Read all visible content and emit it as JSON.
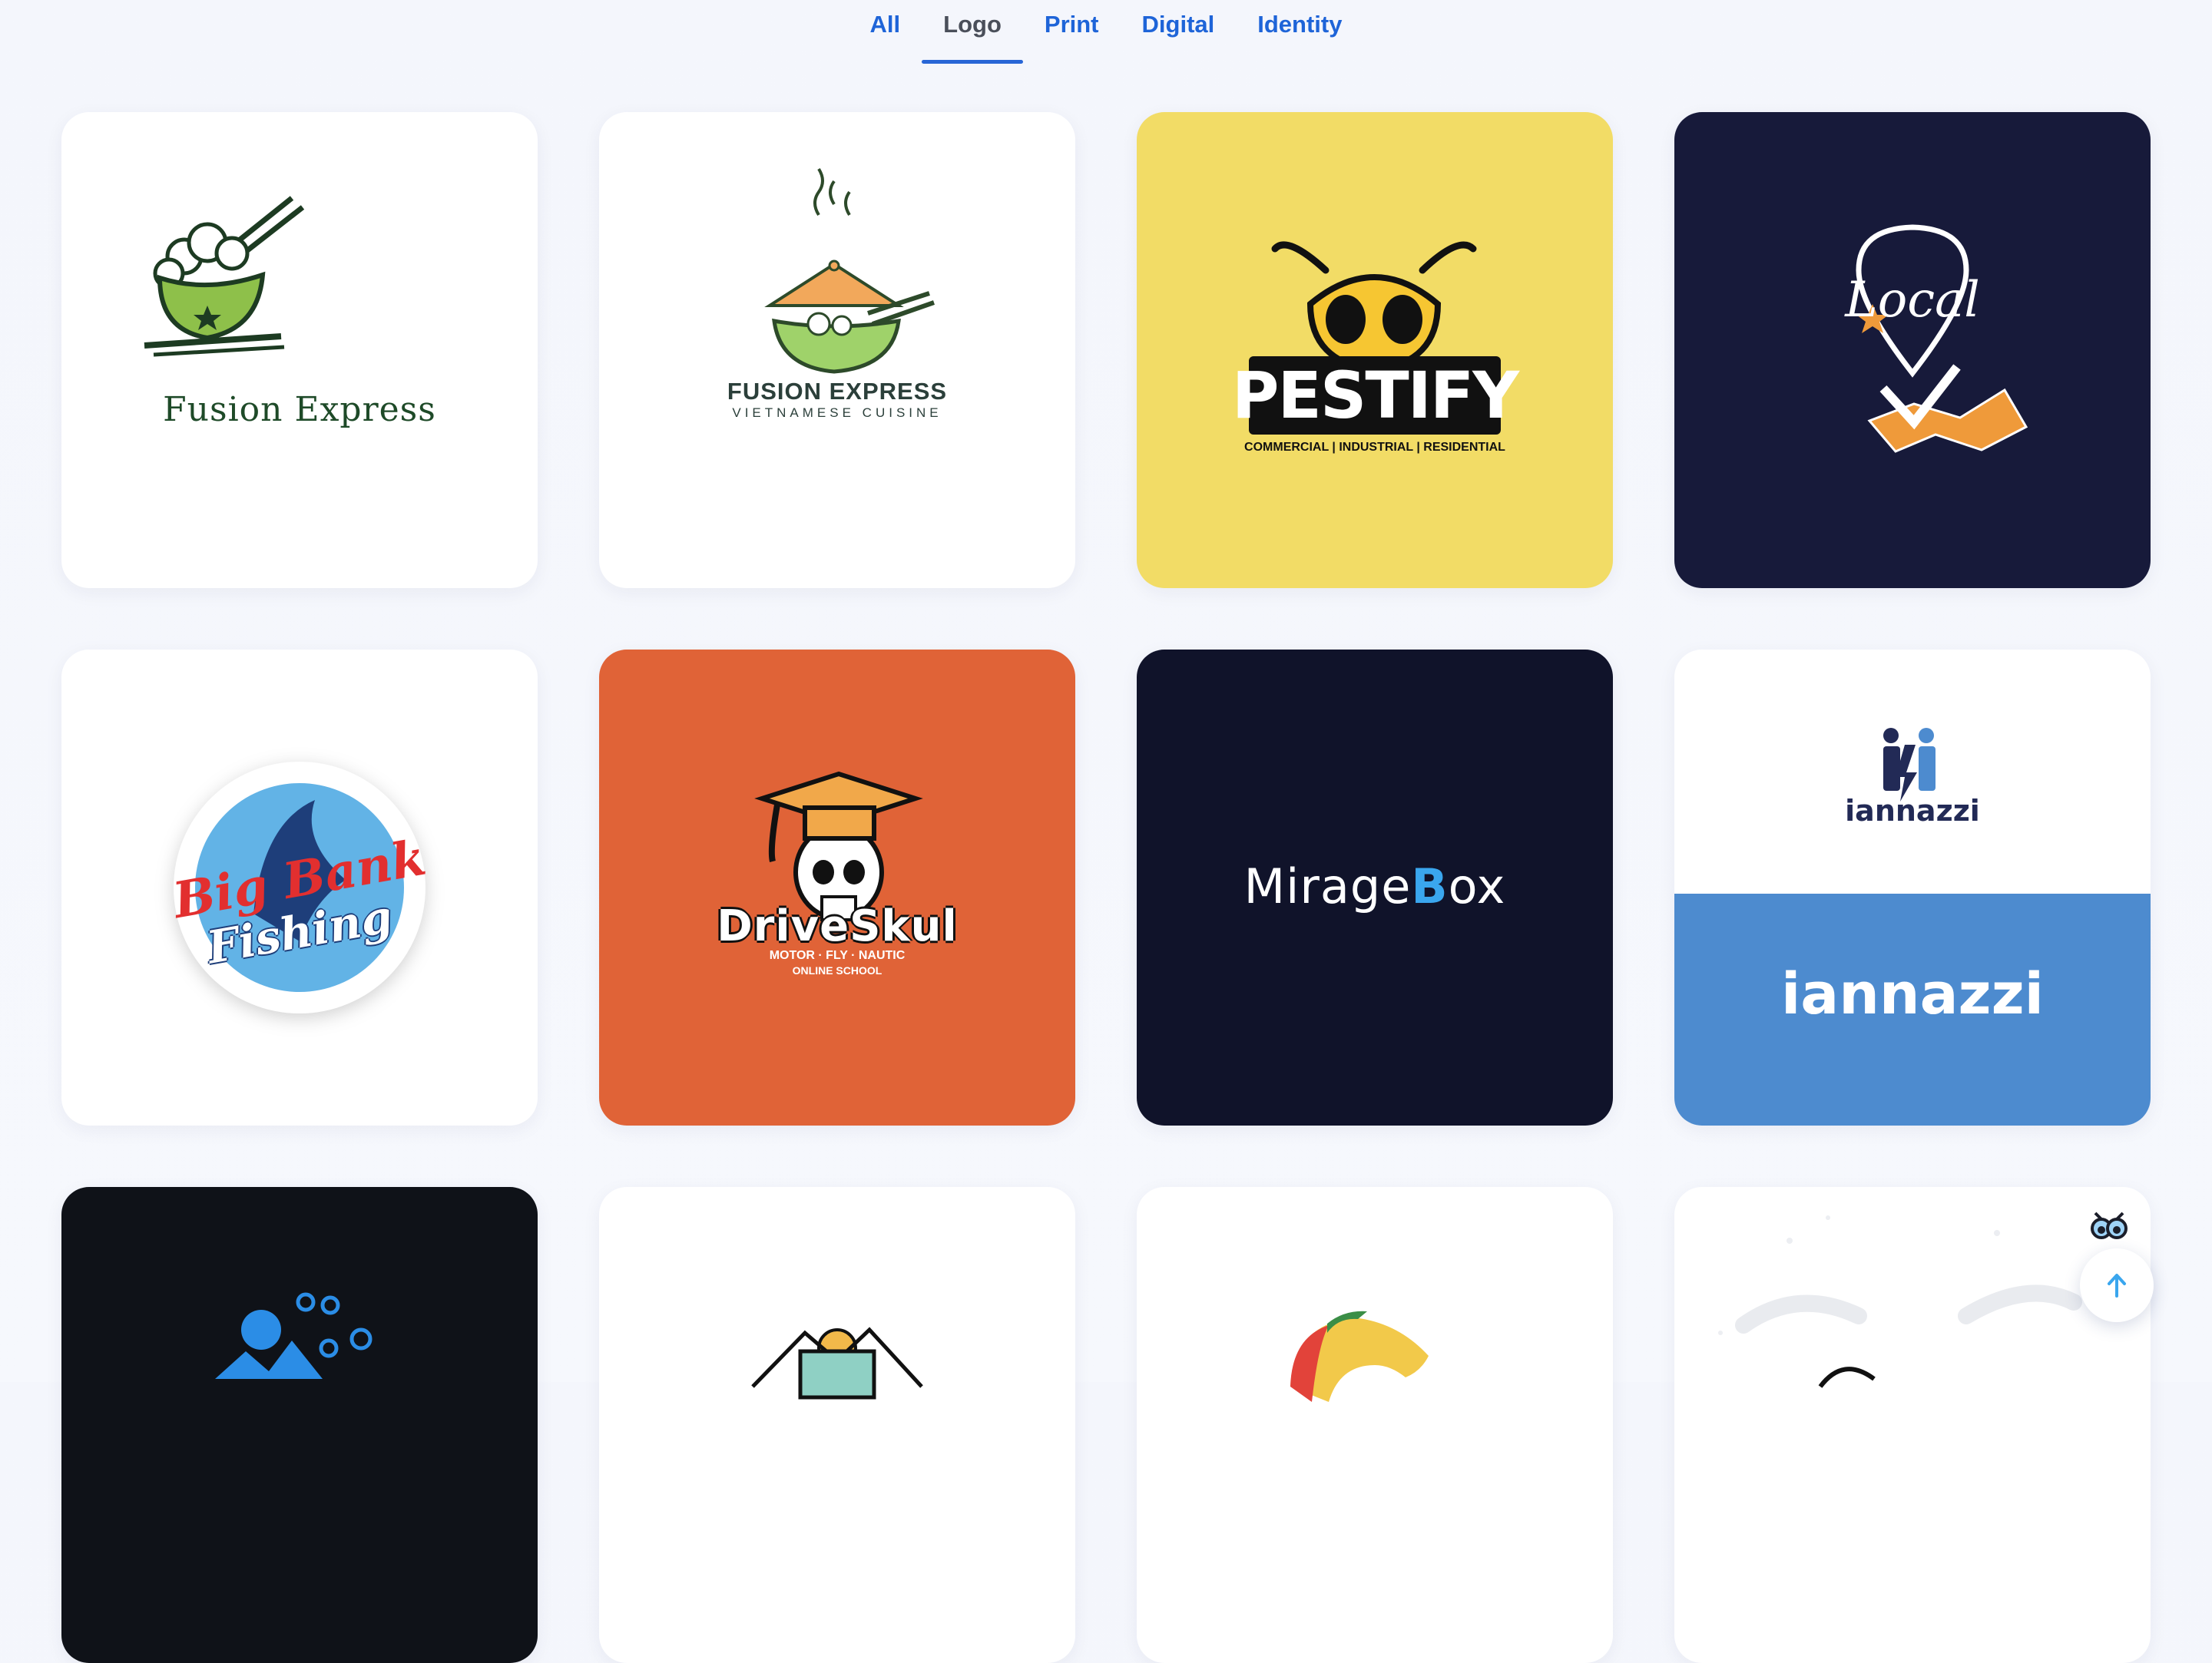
{
  "tabs": [
    {
      "label": "All",
      "active": false
    },
    {
      "label": "Logo",
      "active": true
    },
    {
      "label": "Print",
      "active": false
    },
    {
      "label": "Digital",
      "active": false
    },
    {
      "label": "Identity",
      "active": false
    }
  ],
  "cards": {
    "fusion1": {
      "name": "Fusion Express"
    },
    "fusion2": {
      "name": "FUSION EXPRESS",
      "tagline": "VIETNAMESE CUISINE"
    },
    "pestify": {
      "name": "PESTIFY",
      "tagline": "COMMERCIAL | INDUSTRIAL | RESIDENTIAL"
    },
    "local": {
      "name": "Local"
    },
    "bigbank": {
      "line1": "Big Bank",
      "line2": "Fishing"
    },
    "driveskul": {
      "name": "DriveSkul",
      "tagline1": "MOTOR · FLY · NAUTIC",
      "tagline2": "ONLINE SCHOOL"
    },
    "miragebox": {
      "part1": "Mirage",
      "part2": "B",
      "part3": "ox"
    },
    "iannazzi": {
      "name_top": "iannazzi",
      "name_bottom": "iannazzi"
    }
  },
  "colors": {
    "accent": "#1e64d8",
    "yellow_card": "#f2dc66",
    "navy_card": "#171a3a",
    "orange_card": "#e06337",
    "blue_card": "#4d8bcf"
  },
  "icons": {
    "scroll_top": "arrow-up-icon",
    "helper": "owl-icon"
  }
}
